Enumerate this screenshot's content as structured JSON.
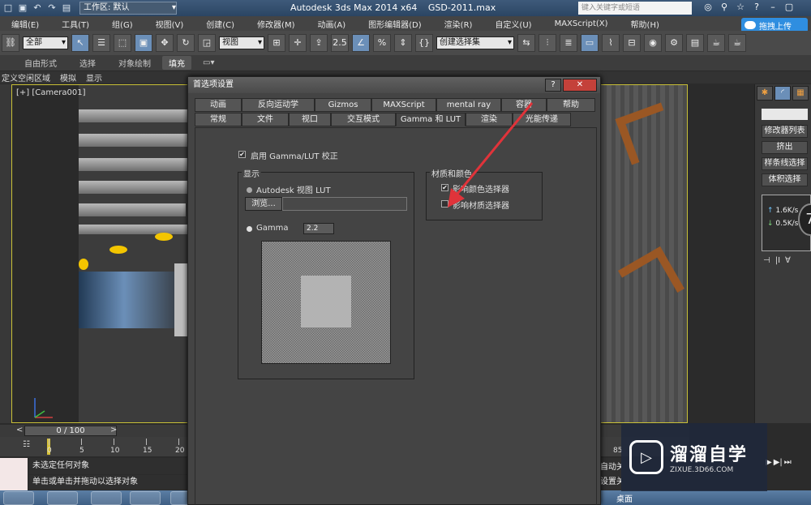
{
  "titlebar": {
    "workspace_label": "工作区: 默认",
    "app_name": "Autodesk 3ds Max  2014 x64",
    "file_name": "GSD-2011.max",
    "search_placeholder": "键入关键字或短语"
  },
  "upload": {
    "label": "拖拽上传"
  },
  "menu": {
    "items": [
      "编辑(E)",
      "工具(T)",
      "组(G)",
      "视图(V)",
      "创建(C)",
      "修改器(M)",
      "动画(A)",
      "图形编辑器(D)",
      "渲染(R)",
      "自定义(U)",
      "MAXScript(X)",
      "帮助(H)"
    ]
  },
  "toolbar": {
    "filter_select": "全部",
    "view_select": "视图",
    "snap_value": "2.5",
    "selection_set_select": "创建选择集"
  },
  "ribbon": {
    "items": [
      "自由形式",
      "选择",
      "对象绘制",
      "填充"
    ]
  },
  "subbar": {
    "items": [
      "定义空闲区域",
      "模拟",
      "显示"
    ]
  },
  "viewport": {
    "label": "[+] [Camera001]"
  },
  "command_panel": {
    "modifier_list": "修改器列表",
    "buttons": [
      "挤出",
      "样条线选择",
      "体积选择"
    ],
    "speed_up": "1.6K/s",
    "speed_down": "0.5K/s",
    "percent": "7"
  },
  "timeline": {
    "frame_display": "0 / 100",
    "ticks": [
      "0",
      "5",
      "10",
      "15",
      "20"
    ],
    "right_tick": "85"
  },
  "status": {
    "line1": "未选定任何对象",
    "line2": "单击或单击并拖动以选择对象",
    "right_line1": "自动关",
    "right_line2": "设置关"
  },
  "taskbar": {
    "tray_text": "桌面"
  },
  "watermark": {
    "title": "溜溜自学",
    "url": "ZIXUE.3D66.COM"
  },
  "dialog": {
    "title": "首选项设置",
    "help_button": "?",
    "close_button": "✕",
    "tabs_row1": [
      "动画",
      "反向运动学",
      "Gizmos",
      "MAXScript",
      "mental ray",
      "容器",
      "帮助"
    ],
    "tabs_row2": [
      "常规",
      "文件",
      "视口",
      "交互模式",
      "Gamma 和 LUT",
      "渲染",
      "光能传递"
    ],
    "active_tab": "Gamma 和 LUT",
    "enable_label": "启用 Gamma/LUT 校正",
    "display_group": "显示",
    "lut_label": "Autodesk 视图 LUT",
    "browse_label": "浏览...",
    "gamma_label": "Gamma",
    "gamma_value": "2.2",
    "materials_group": "材质和颜色",
    "affect_color_label": "影响颜色选择器",
    "affect_material_label": "影响材质选择器"
  },
  "colors": {
    "accent": "#6b8fb8",
    "viewport_border": "#c9c037",
    "arrow": "#e0333a",
    "close_button": "#c4413a"
  }
}
